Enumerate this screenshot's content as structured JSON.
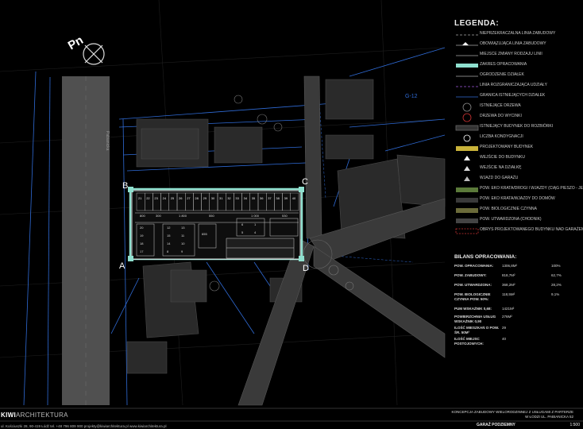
{
  "north": "Pn",
  "street_label": "Pabianicka",
  "plot_labels": {
    "A": "A",
    "B": "B",
    "C": "C",
    "D": "D"
  },
  "zone_label": "A-D",
  "road_label": "G-12",
  "spot_numbers_top": [
    "21",
    "22",
    "23",
    "24",
    "25",
    "26",
    "27",
    "28",
    "29",
    "30",
    "31",
    "32",
    "33",
    "34",
    "35",
    "36",
    "37",
    "38",
    "39",
    "40"
  ],
  "legend": {
    "title": "LEGENDA:",
    "items": [
      {
        "text": "NIEPRZEKRACZALNA LINIA ZABUDOWY",
        "symbol": "dashed-line-icon"
      },
      {
        "text": "OBOWIĄZUJĄCA LINIA ZABUDOWY",
        "symbol": "triangle-line-icon"
      },
      {
        "text": "MIEJSCE ZMIANY RODZAJU LINII",
        "symbol": "junction-icon"
      },
      {
        "text": "ZAKRES OPRACOWANIA",
        "symbol": "boundary-icon"
      },
      {
        "text": "OGRODZENIE DZIAŁEK",
        "symbol": "fence-icon"
      },
      {
        "text": "LINIA ROZGRANICZAJĄCA UDZIAŁY",
        "symbol": "purple-line-icon"
      },
      {
        "text": "GRANICA ISTNIEJĄCYCH DZIAŁEK",
        "symbol": "blue-line-icon"
      },
      {
        "text": "ISTNIEJĄCE DRZEWA",
        "symbol": "tree-icon"
      },
      {
        "text": "DRZEWA DO WYCINKI",
        "symbol": "tree-cut-icon"
      },
      {
        "text": "ISTNIEJĄCY BUDYNEK DO ROZBIÓRKI",
        "symbol": "demolish-icon"
      },
      {
        "text": "LICZBA KONDYGNACJI",
        "symbol": "floors-icon"
      },
      {
        "text": "PROJEKTOWANY BUDYNEK",
        "symbol": "new-building-icon"
      },
      {
        "text": "WEJŚCIE DO BUDYNKU",
        "symbol": "entry-icon"
      },
      {
        "text": "WEJŚCIE NA DZIAŁKĘ",
        "symbol": "plot-entry-icon"
      },
      {
        "text": "WJAZD DO GARAŻU",
        "symbol": "garage-entry-icon"
      },
      {
        "text": "POW. EKO KRATA/DROGI I WJAZDY (CIĄG PIESZO - JEZDNY)",
        "symbol": "eco-grid-icon"
      },
      {
        "text": "POW. EKO KRATA/WJAZDY DO DOMÓW",
        "symbol": "eco-drive-icon"
      },
      {
        "text": "POW. BIOLOGICZNIE CZYNNA",
        "symbol": "bio-area-icon"
      },
      {
        "text": "POW. UTWARDZONA (CHODNIK)",
        "symbol": "paved-icon"
      },
      {
        "text": "OBRYS PROJEKTOWANEGO BUDYNKU NAD GARAŻEM",
        "symbol": "outline-icon"
      }
    ]
  },
  "bilans": {
    "title": "BILANS OPRACOWANIA:",
    "rows": [
      {
        "label": "POW. OPRACOWANIA:",
        "value": "1306,8m²",
        "pct": "100%"
      },
      {
        "label": "POW. ZABUDOWY:",
        "value": "818,7m²",
        "pct": "62,7%"
      },
      {
        "label": "POW. UTWARDZONA:",
        "value": "368,2m²",
        "pct": "28,2%"
      },
      {
        "label": "POW. BIOLOGICZNIE CZYNNA POW. 50%:",
        "value": "118,5m²",
        "pct": "9,1%"
      },
      {
        "label": "PUM WSKAŹNIK 0,68:",
        "value": "1421m²",
        "pct": ""
      },
      {
        "label": "POWIERZCHNIA USŁUG WSKAŹNIK 0,90",
        "value": "276m²",
        "pct": ""
      },
      {
        "label": "ILOŚĆ MIESZKAŃ O POW. ŚR. 50M²",
        "value": "29",
        "pct": ""
      },
      {
        "label": "ILOŚĆ MIEJSC POSTOJOWYCH:",
        "value": "40",
        "pct": ""
      }
    ]
  },
  "footer": {
    "logo_kiwi": "KIWI",
    "logo_arch": "ARCHITEKTURA",
    "contact": "ul. Kościuszki 28, 90-419 Łódź  tel. +48 796 809 900  projekty@kiwiarchitektura.pl  www.kiwiarchitektura.pl",
    "project_line1": "KONCEPCJA ZABUDOWY WIELORODZINNEJ Z USŁUGAMI Z PARTERZE",
    "project_line2": "W ŁODZI UL. PABIANICKA 52",
    "sheet": "GARAŻ PODZIEMNY",
    "scale": "1:500"
  },
  "colors": {
    "accent": "#8fe0cf",
    "blue": "#2f6bd6",
    "gold": "#c9b33a",
    "green": "#5b7a3a"
  }
}
